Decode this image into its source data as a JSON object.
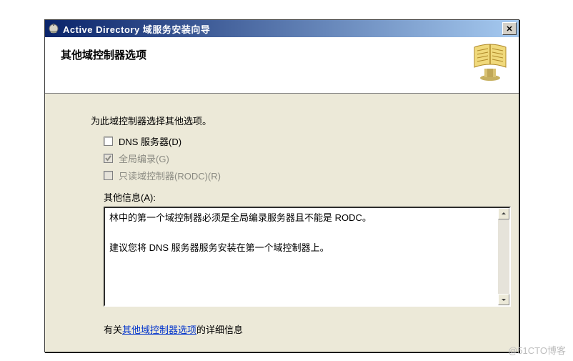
{
  "window": {
    "title": "Active Directory 域服务安装向导",
    "close_glyph": "✕"
  },
  "header": {
    "page_title": "其他域控制器选项"
  },
  "body": {
    "instruction": "为此域控制器选择其他选项。",
    "options": {
      "dns": {
        "label": "DNS 服务器(D)",
        "checked": false,
        "disabled": false
      },
      "gc": {
        "label": "全局编录(G)",
        "checked": true,
        "disabled": true
      },
      "rodc": {
        "label": "只读域控制器(RODC)(R)",
        "checked": false,
        "disabled": true
      }
    },
    "other_info_label": "其他信息(A):",
    "other_info_text": "林中的第一个域控制器必须是全局编录服务器且不能是 RODC。\n\n建议您将 DNS 服务器服务安装在第一个域控制器上。"
  },
  "footer": {
    "prefix": "有关",
    "link": "其他域控制器选项",
    "suffix": "的详细信息"
  },
  "watermark": "@51CTO博客"
}
